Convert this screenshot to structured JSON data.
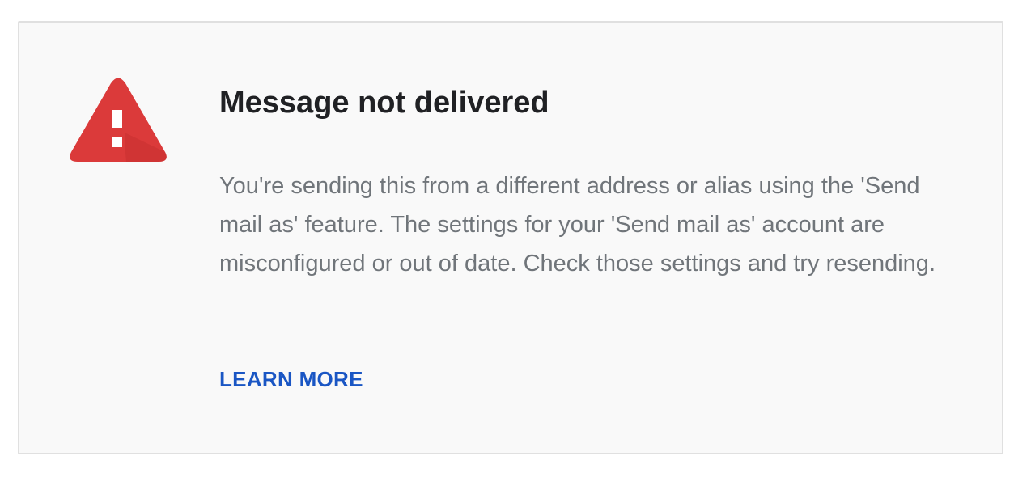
{
  "error_card": {
    "icon": "warning-triangle-icon",
    "icon_color": "#db3a3a",
    "title": "Message not delivered",
    "message": "You're sending this from a different address or alias using the 'Send mail as' feature. The settings for your 'Send mail as' account are misconfigured or out of date. Check those settings and try resending.",
    "learn_more_label": "LEARN MORE",
    "link_color": "#1a56c4"
  }
}
